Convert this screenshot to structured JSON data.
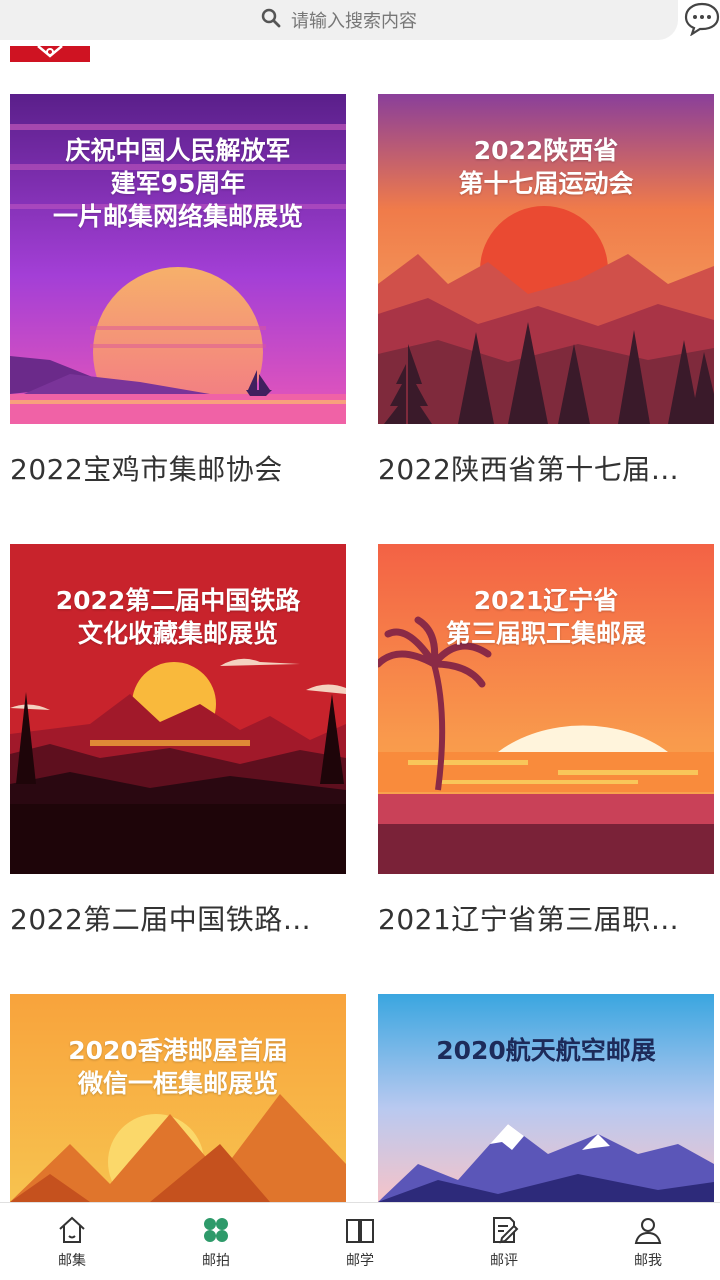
{
  "search": {
    "placeholder": "请输入搜索内容"
  },
  "exhibitions": [
    {
      "cover_title_lines": [
        "庆祝中国人民解放军",
        "建军95周年",
        "一片邮集网络集邮展览"
      ],
      "caption": "2022宝鸡市集邮协会"
    },
    {
      "cover_title_lines": [
        "2022陕西省",
        "第十七届运动会"
      ],
      "caption": "2022陕西省第十七届…"
    },
    {
      "cover_title_lines": [
        "2022第二届中国铁路",
        "文化收藏集邮展览"
      ],
      "caption": "2022第二届中国铁路…"
    },
    {
      "cover_title_lines": [
        "2021辽宁省",
        "第三届职工集邮展"
      ],
      "caption": "2021辽宁省第三届职…"
    },
    {
      "cover_title_lines": [
        "2020香港邮屋首届",
        "微信一框集邮展览"
      ],
      "caption": ""
    },
    {
      "cover_title_lines": [
        "2020航天航空邮展"
      ],
      "caption": ""
    }
  ],
  "tabbar": {
    "items": [
      {
        "label": "邮集",
        "icon": "home-icon"
      },
      {
        "label": "邮拍",
        "icon": "clover-icon",
        "color": "#2e9a6a"
      },
      {
        "label": "邮学",
        "icon": "book-icon"
      },
      {
        "label": "邮评",
        "icon": "edit-icon"
      },
      {
        "label": "邮我",
        "icon": "person-icon"
      }
    ]
  },
  "colors": {
    "brand_red": "#cf1322",
    "accent_green": "#2e9a6a"
  }
}
